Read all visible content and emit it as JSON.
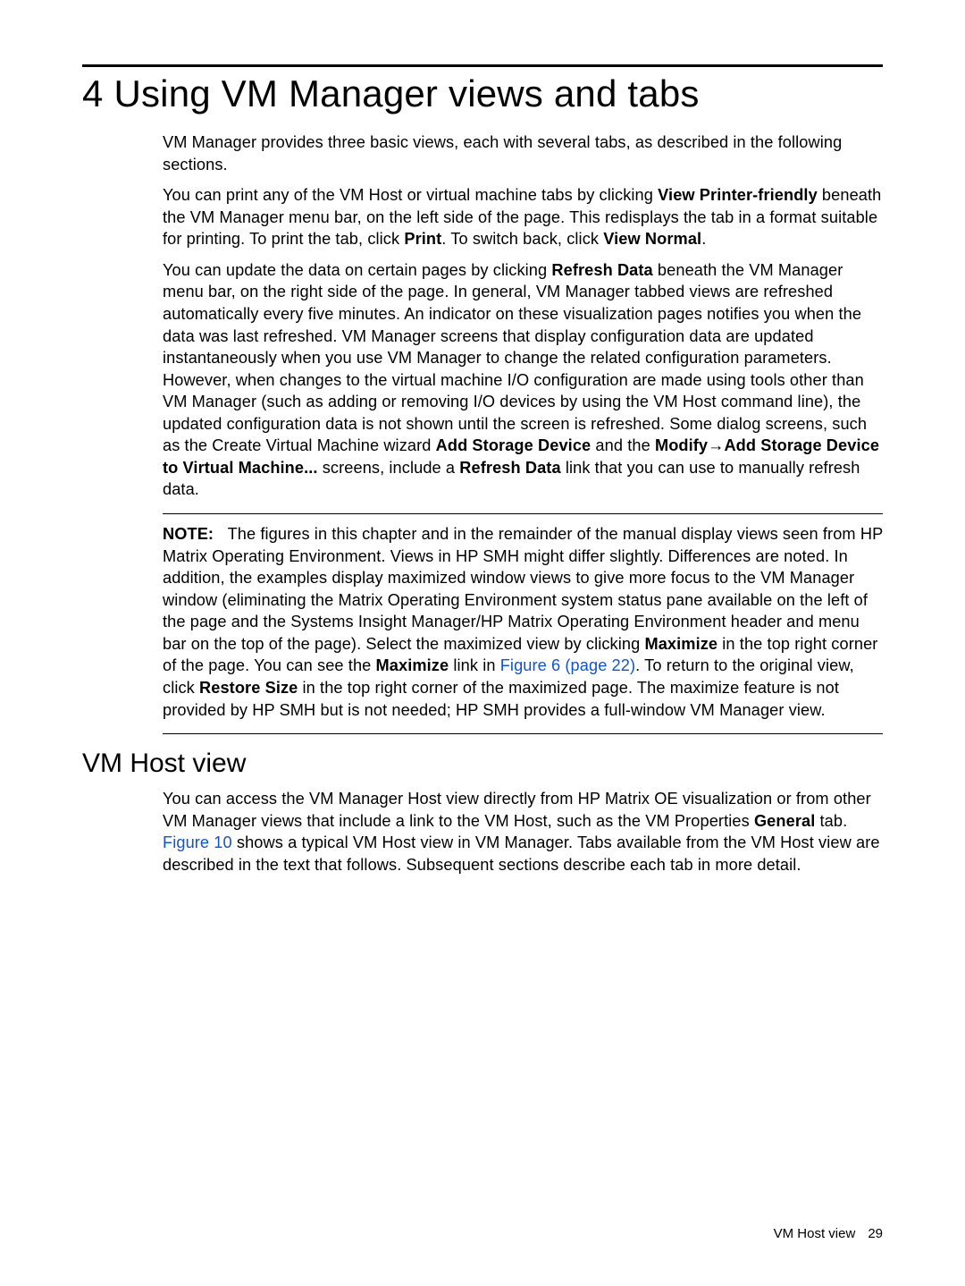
{
  "chapter": {
    "number": "4",
    "title": "Using VM Manager views and tabs"
  },
  "para1": "VM Manager provides three basic views, each with several tabs, as described in the following sections.",
  "para2": {
    "t1": "You can print any of the VM Host or virtual machine tabs by clicking ",
    "b1": "View Printer-friendly",
    "t2": " beneath the VM Manager menu bar, on the left side of the page. This redisplays the tab in a format suitable for printing. To print the tab, click ",
    "b2": "Print",
    "t3": ". To switch back, click ",
    "b3": "View Normal",
    "t4": "."
  },
  "para3": {
    "t1": "You can update the data on certain pages by clicking ",
    "b1": "Refresh Data",
    "t2": " beneath the VM Manager menu bar, on the right side of the page. In general, VM Manager tabbed views are refreshed automatically every five minutes. An indicator on these visualization pages notifies you when the data was last refreshed. VM Manager screens that display configuration data are updated instantaneously when you use VM Manager to change the related configuration parameters. However, when changes to the virtual machine I/O configuration are made using tools other than VM Manager (such as adding or removing I/O devices by using the VM Host command line), the updated configuration data is not shown until the screen is refreshed. Some dialog screens, such as the Create Virtual Machine wizard ",
    "b2": "Add Storage Device",
    "t3": " and the ",
    "b3": "Modify",
    "arrow": "→",
    "b4": "Add Storage Device to Virtual Machine...",
    "t4": " screens, include a ",
    "b5": "Refresh Data",
    "t5": " link that you can use to manually refresh data."
  },
  "note": {
    "label": "NOTE:",
    "t1": "The figures in this chapter and in the remainder of the manual display views seen from HP Matrix Operating Environment. Views in HP SMH might differ slightly. Differences are noted. In addition, the examples display maximized window views to give more focus to the VM Manager window (eliminating the Matrix Operating Environment system status pane available on the left of the page and the Systems Insight Manager/HP Matrix Operating Environment header and menu bar on the top of the page). Select the maximized view by clicking ",
    "b1": "Maximize",
    "t2": " in the top right corner of the page. You can see the ",
    "b2": "Maximize",
    "t3": " link in ",
    "link1": "Figure 6 (page 22)",
    "t4": ". To return to the original view, click ",
    "b3": "Restore Size",
    "t5": " in the top right corner of the maximized page. The maximize feature is not provided by HP SMH but is not needed; HP SMH provides a full-window VM Manager view."
  },
  "section": {
    "title": "VM Host view"
  },
  "para4": {
    "t1": "You can access the VM Manager Host view directly from HP Matrix OE visualization or from other VM Manager views that include a link to the VM Host, such as the VM Properties ",
    "b1": "General",
    "t2": " tab. ",
    "link1": "Figure 10",
    "t3": " shows a typical VM Host view in VM Manager. Tabs available from the VM Host view are described in the text that follows. Subsequent sections describe each tab in more detail."
  },
  "footer": {
    "text": "VM Host view",
    "page": "29"
  }
}
